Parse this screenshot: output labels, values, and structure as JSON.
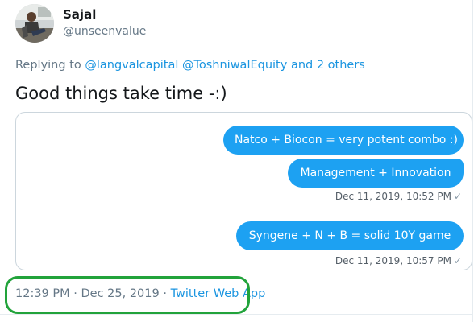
{
  "tweet": {
    "author": {
      "name": "Sajal",
      "handle": "@unseenvalue"
    },
    "replying": {
      "prefix": "Replying to",
      "user1": "@langvalcapital",
      "user2": "@ToshniwalEquity",
      "others": "and 2 others"
    },
    "text": "Good things take time -:)",
    "media": {
      "messages": [
        {
          "text": "Natco + Biocon = very potent combo :)"
        },
        {
          "text": "Management + Innovation"
        },
        {
          "text": "Syngene + N + B = solid 10Y game"
        }
      ],
      "stamps": [
        {
          "time": "Dec 11, 2019, 10:52 PM",
          "check": "✓"
        },
        {
          "time": "Dec 11, 2019, 10:57 PM",
          "check": "✓"
        }
      ]
    },
    "meta": {
      "time": "12:39 PM",
      "sep1": " · ",
      "date": "Dec 25, 2019",
      "sep2": " · ",
      "app": "Twitter Web App"
    }
  },
  "colors": {
    "link": "#1b95e0",
    "bubble": "#1da1f2",
    "highlight": "#22a33b",
    "muted": "#657786"
  }
}
